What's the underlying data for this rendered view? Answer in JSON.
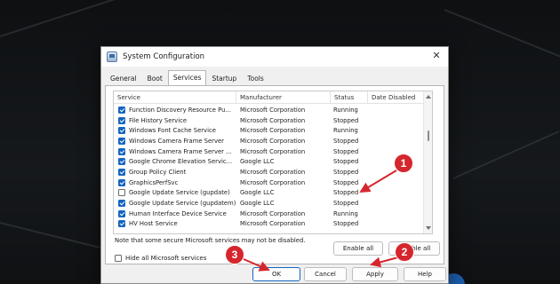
{
  "window": {
    "title": "System Configuration"
  },
  "tabs": [
    {
      "label": "General"
    },
    {
      "label": "Boot"
    },
    {
      "label": "Services"
    },
    {
      "label": "Startup"
    },
    {
      "label": "Tools"
    }
  ],
  "active_tab": "Services",
  "table": {
    "columns": [
      "Service",
      "Manufacturer",
      "Status",
      "Date Disabled"
    ],
    "rows": [
      {
        "service": "Function Discovery Resource Pu...",
        "manufacturer": "Microsoft Corporation",
        "status": "Running",
        "date_disabled": "",
        "checked": true
      },
      {
        "service": "File History Service",
        "manufacturer": "Microsoft Corporation",
        "status": "Stopped",
        "date_disabled": "",
        "checked": true
      },
      {
        "service": "Windows Font Cache Service",
        "manufacturer": "Microsoft Corporation",
        "status": "Running",
        "date_disabled": "",
        "checked": true
      },
      {
        "service": "Windows Camera Frame Server",
        "manufacturer": "Microsoft Corporation",
        "status": "Stopped",
        "date_disabled": "",
        "checked": true
      },
      {
        "service": "Windows Camera Frame Server ...",
        "manufacturer": "Microsoft Corporation",
        "status": "Stopped",
        "date_disabled": "",
        "checked": true
      },
      {
        "service": "Google Chrome Elevation Servic...",
        "manufacturer": "Google LLC",
        "status": "Stopped",
        "date_disabled": "",
        "checked": true
      },
      {
        "service": "Group Policy Client",
        "manufacturer": "Microsoft Corporation",
        "status": "Stopped",
        "date_disabled": "",
        "checked": true
      },
      {
        "service": "GraphicsPerfSvc",
        "manufacturer": "Microsoft Corporation",
        "status": "Stopped",
        "date_disabled": "",
        "checked": true
      },
      {
        "service": "Google Update Service (gupdate)",
        "manufacturer": "Google LLC",
        "status": "Stopped",
        "date_disabled": "",
        "checked": false
      },
      {
        "service": "Google Update Service (gupdatem)",
        "manufacturer": "Google LLC",
        "status": "Stopped",
        "date_disabled": "",
        "checked": true
      },
      {
        "service": "Human Interface Device Service",
        "manufacturer": "Microsoft Corporation",
        "status": "Running",
        "date_disabled": "",
        "checked": true
      },
      {
        "service": "HV Host Service",
        "manufacturer": "Microsoft Corporation",
        "status": "Stopped",
        "date_disabled": "",
        "checked": true
      }
    ]
  },
  "note": "Note that some secure Microsoft services may not be disabled.",
  "buttons": {
    "enable_all": "Enable all",
    "disable_all": "Disable all",
    "ok": "OK",
    "cancel": "Cancel",
    "apply": "Apply",
    "help": "Help"
  },
  "hide_ms": {
    "label": "Hide all Microsoft services",
    "checked": false
  },
  "annotations": {
    "badge1": "1",
    "badge2": "2",
    "badge3": "3",
    "color": "#d6262d"
  },
  "accent": "#1565c0"
}
